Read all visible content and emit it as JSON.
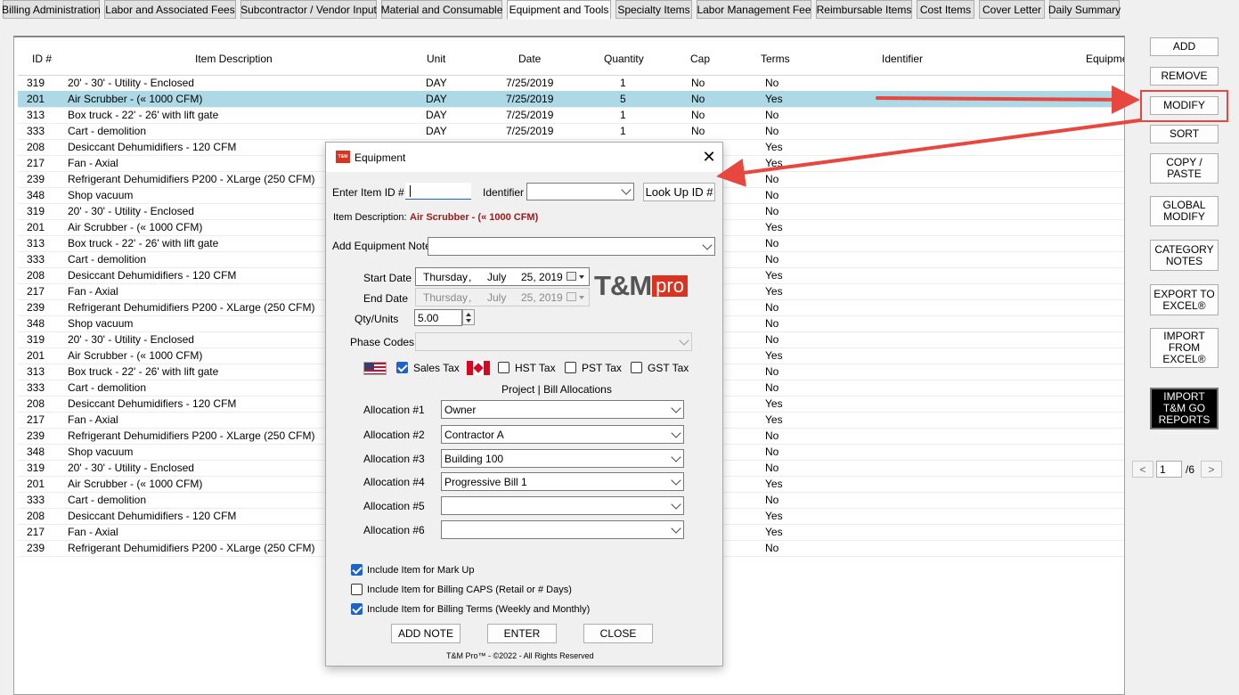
{
  "tabs": [
    "Billing Administration",
    "Labor and Associated Fees",
    "Subcontractor / Vendor Input",
    "Material and Consumable",
    "Equipment and Tools",
    "Specialty Items",
    "Labor Management Fee",
    "Reimbursable Items",
    "Cost Items",
    "Cover Letter",
    "Daily Summary"
  ],
  "active_tab": "Equipment and Tools",
  "grid": {
    "headers": [
      "ID #",
      "Item Description",
      "Unit",
      "Date",
      "Quantity",
      "Cap",
      "Terms",
      "Identifier",
      "Equipme"
    ],
    "rows": [
      {
        "id": "319",
        "desc": "20' - 30' - Utility - Enclosed",
        "unit": "DAY",
        "date": "7/25/2019",
        "qty": "1",
        "cap": "No",
        "terms": "No"
      },
      {
        "id": "201",
        "desc": "Air Scrubber - (« 1000 CFM)",
        "unit": "DAY",
        "date": "7/25/2019",
        "qty": "5",
        "cap": "No",
        "terms": "Yes"
      },
      {
        "id": "313",
        "desc": "Box truck - 22' - 26' with lift gate",
        "unit": "DAY",
        "date": "7/25/2019",
        "qty": "1",
        "cap": "No",
        "terms": "No"
      },
      {
        "id": "333",
        "desc": "Cart - demolition",
        "unit": "DAY",
        "date": "7/25/2019",
        "qty": "1",
        "cap": "No",
        "terms": "No"
      },
      {
        "id": "208",
        "desc": "Desiccant Dehumidifiers - 120 CFM",
        "unit": "",
        "date": "",
        "qty": "",
        "cap": "",
        "terms": "Yes"
      },
      {
        "id": "217",
        "desc": "Fan - Axial",
        "unit": "",
        "date": "",
        "qty": "",
        "cap": "",
        "terms": "Yes"
      },
      {
        "id": "239",
        "desc": "Refrigerant Dehumidifiers P200 - XLarge (250 CFM)",
        "unit": "",
        "date": "",
        "qty": "",
        "cap": "",
        "terms": "No"
      },
      {
        "id": "348",
        "desc": "Shop vacuum",
        "unit": "",
        "date": "",
        "qty": "",
        "cap": "",
        "terms": "No"
      },
      {
        "id": "319",
        "desc": "20' - 30' - Utility - Enclosed",
        "unit": "",
        "date": "",
        "qty": "",
        "cap": "",
        "terms": "No"
      },
      {
        "id": "201",
        "desc": "Air Scrubber - (« 1000 CFM)",
        "unit": "",
        "date": "",
        "qty": "",
        "cap": "",
        "terms": "Yes"
      },
      {
        "id": "313",
        "desc": "Box truck - 22' - 26' with lift gate",
        "unit": "",
        "date": "",
        "qty": "",
        "cap": "",
        "terms": "No"
      },
      {
        "id": "333",
        "desc": "Cart - demolition",
        "unit": "",
        "date": "",
        "qty": "",
        "cap": "",
        "terms": "No"
      },
      {
        "id": "208",
        "desc": "Desiccant Dehumidifiers - 120 CFM",
        "unit": "",
        "date": "",
        "qty": "",
        "cap": "",
        "terms": "Yes"
      },
      {
        "id": "217",
        "desc": "Fan - Axial",
        "unit": "",
        "date": "",
        "qty": "",
        "cap": "",
        "terms": "Yes"
      },
      {
        "id": "239",
        "desc": "Refrigerant Dehumidifiers P200 - XLarge (250 CFM)",
        "unit": "",
        "date": "",
        "qty": "",
        "cap": "",
        "terms": "No"
      },
      {
        "id": "348",
        "desc": "Shop vacuum",
        "unit": "",
        "date": "",
        "qty": "",
        "cap": "",
        "terms": "No"
      },
      {
        "id": "319",
        "desc": "20' - 30' - Utility - Enclosed",
        "unit": "",
        "date": "",
        "qty": "",
        "cap": "",
        "terms": "No"
      },
      {
        "id": "201",
        "desc": "Air Scrubber - (« 1000 CFM)",
        "unit": "",
        "date": "",
        "qty": "",
        "cap": "",
        "terms": "Yes"
      },
      {
        "id": "313",
        "desc": "Box truck - 22' - 26' with lift gate",
        "unit": "",
        "date": "",
        "qty": "",
        "cap": "",
        "terms": "No"
      },
      {
        "id": "333",
        "desc": "Cart - demolition",
        "unit": "",
        "date": "",
        "qty": "",
        "cap": "",
        "terms": "No"
      },
      {
        "id": "208",
        "desc": "Desiccant Dehumidifiers - 120 CFM",
        "unit": "",
        "date": "",
        "qty": "",
        "cap": "",
        "terms": "Yes"
      },
      {
        "id": "217",
        "desc": "Fan - Axial",
        "unit": "",
        "date": "",
        "qty": "",
        "cap": "",
        "terms": "Yes"
      },
      {
        "id": "239",
        "desc": "Refrigerant Dehumidifiers P200 - XLarge (250 CFM)",
        "unit": "",
        "date": "",
        "qty": "",
        "cap": "",
        "terms": "No"
      },
      {
        "id": "348",
        "desc": "Shop vacuum",
        "unit": "",
        "date": "",
        "qty": "",
        "cap": "",
        "terms": "No"
      },
      {
        "id": "319",
        "desc": "20' - 30' - Utility - Enclosed",
        "unit": "",
        "date": "",
        "qty": "",
        "cap": "",
        "terms": "No"
      },
      {
        "id": "201",
        "desc": "Air Scrubber - (« 1000 CFM)",
        "unit": "",
        "date": "",
        "qty": "",
        "cap": "",
        "terms": "Yes"
      },
      {
        "id": "333",
        "desc": "Cart - demolition",
        "unit": "",
        "date": "",
        "qty": "",
        "cap": "",
        "terms": "No"
      },
      {
        "id": "208",
        "desc": "Desiccant Dehumidifiers - 120 CFM",
        "unit": "",
        "date": "",
        "qty": "",
        "cap": "",
        "terms": "Yes"
      },
      {
        "id": "217",
        "desc": "Fan - Axial",
        "unit": "",
        "date": "",
        "qty": "",
        "cap": "",
        "terms": "Yes"
      },
      {
        "id": "239",
        "desc": "Refrigerant Dehumidifiers P200 - XLarge (250 CFM)",
        "unit": "",
        "date": "",
        "qty": "",
        "cap": "",
        "terms": "No"
      }
    ],
    "selected_row_index": 1
  },
  "side_buttons": {
    "add": "ADD",
    "remove": "REMOVE",
    "modify": "MODIFY",
    "sort": "SORT",
    "copy_paste": [
      "COPY /",
      "PASTE"
    ],
    "global_modify": [
      "GLOBAL",
      "MODIFY"
    ],
    "category_notes": [
      "CATEGORY",
      "NOTES"
    ],
    "export_excel": [
      "EXPORT TO",
      "EXCEL®"
    ],
    "import_excel": [
      "IMPORT",
      "FROM",
      "EXCEL®"
    ],
    "import_tm_go": [
      "IMPORT",
      "T&M GO",
      "REPORTS"
    ]
  },
  "pagination": {
    "prev": "<",
    "next": ">",
    "current": "1",
    "total": "/6"
  },
  "dialog": {
    "icon_text": "T&M",
    "title": "Equipment",
    "close_glyph": "✕",
    "enter_item_label": "Enter Item ID #",
    "enter_item_value": "",
    "identifier_label": "Identifier",
    "identifier_value": "",
    "lookup_button": "Look Up ID #",
    "item_desc_label": "Item Description:",
    "item_desc_value": "Air Scrubber - (« 1000 CFM)",
    "equip_note_label": "Add Equipment Note",
    "equip_note_value": "",
    "start_date_label": "Start Date",
    "start_date": {
      "weekday": "Thursday",
      "sep": ",",
      "month": "July",
      "day_year": "25, 2019"
    },
    "end_date_label": "End Date",
    "end_date": {
      "weekday": "Thursday",
      "sep": ",",
      "month": "July",
      "day_year": "25, 2019"
    },
    "qty_label": "Qty/Units",
    "qty_value": "5.00",
    "phase_label": "Phase Codes",
    "phase_value": "",
    "logo": {
      "tm": "T&M",
      "pro": "pro"
    },
    "taxes": [
      {
        "label": "Sales Tax",
        "checked": true
      },
      {
        "label": "HST Tax",
        "checked": false
      },
      {
        "label": "PST Tax",
        "checked": false
      },
      {
        "label": "GST Tax",
        "checked": false
      }
    ],
    "alloc_heading": "Project | Bill Allocations",
    "allocations": [
      {
        "label": "Allocation #1",
        "value": "Owner"
      },
      {
        "label": "Allocation #2",
        "value": "Contractor A"
      },
      {
        "label": "Allocation #3",
        "value": "Building 100"
      },
      {
        "label": "Allocation #4",
        "value": "Progressive Bill 1"
      },
      {
        "label": "Allocation #5",
        "value": ""
      },
      {
        "label": "Allocation #6",
        "value": ""
      }
    ],
    "options": [
      {
        "label": "Include Item for Mark Up",
        "checked": true
      },
      {
        "label": "Include Item for Billing CAPS (Retail or # Days)",
        "checked": false
      },
      {
        "label": "Include Item for Billing Terms (Weekly and Monthly)",
        "checked": true
      }
    ],
    "buttons": {
      "add_note": "ADD NOTE",
      "enter": "ENTER",
      "close": "CLOSE"
    },
    "footer": "T&M Pro™ - ©2022 - All Rights Reserved"
  },
  "colors": {
    "selected_row": "#add8e6",
    "annotation_red": "#e8473f",
    "item_desc_red": "#9a1a1a",
    "logo_red": "#d8341f"
  }
}
